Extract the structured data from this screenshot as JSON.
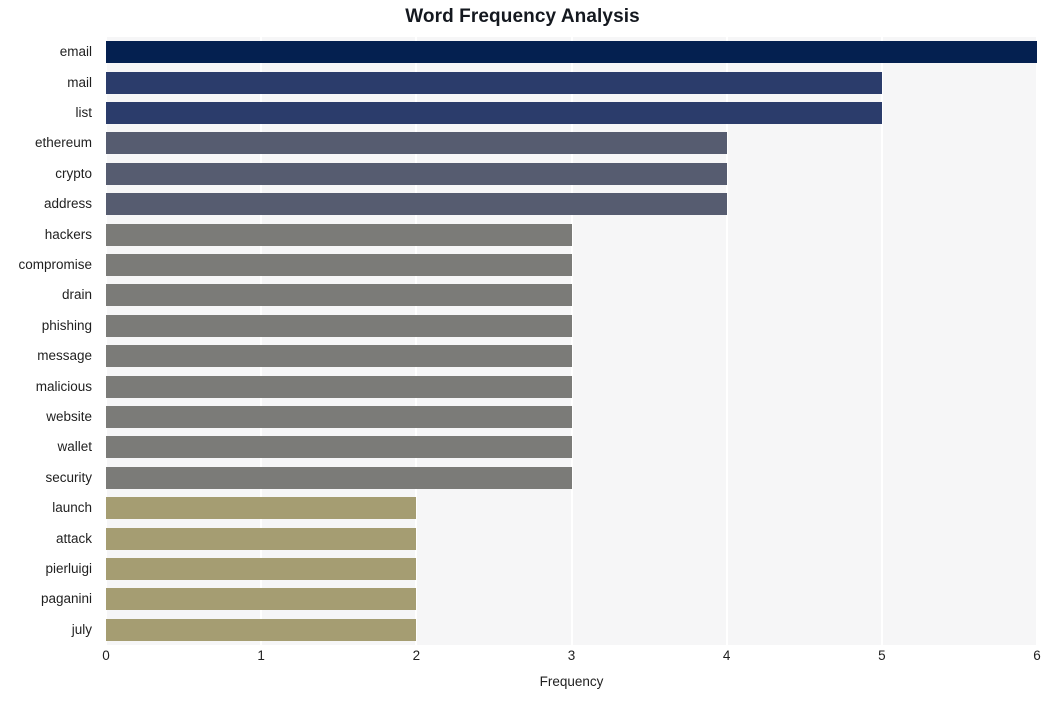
{
  "chart_data": {
    "type": "bar",
    "orientation": "horizontal",
    "title": "Word Frequency Analysis",
    "xlabel": "Frequency",
    "ylabel": "",
    "categories": [
      "email",
      "mail",
      "list",
      "ethereum",
      "crypto",
      "address",
      "hackers",
      "compromise",
      "drain",
      "phishing",
      "message",
      "malicious",
      "website",
      "wallet",
      "security",
      "launch",
      "attack",
      "pierluigi",
      "paganini",
      "july"
    ],
    "values": [
      6,
      5,
      5,
      4,
      4,
      4,
      3,
      3,
      3,
      3,
      3,
      3,
      3,
      3,
      3,
      2,
      2,
      2,
      2,
      2
    ],
    "bar_colors": [
      "#042050",
      "#2b3c6b",
      "#2b3c6b",
      "#565c70",
      "#565c70",
      "#565c70",
      "#7b7b78",
      "#7b7b78",
      "#7b7b78",
      "#7b7b78",
      "#7b7b78",
      "#7b7b78",
      "#7b7b78",
      "#7b7b78",
      "#7b7b78",
      "#a59d72",
      "#a59d72",
      "#a59d72",
      "#a59d72",
      "#a59d72"
    ],
    "xlim": [
      0,
      6
    ],
    "xticks": [
      0,
      1,
      2,
      3,
      4,
      5,
      6
    ],
    "xtick_labels": [
      "0",
      "1",
      "2",
      "3",
      "4",
      "5",
      "6"
    ],
    "grid": true,
    "grid_axis": "x",
    "grid_color": "#ffffff",
    "plot_background": "#f6f6f7",
    "figure_background": "#ffffff",
    "legend": null
  }
}
